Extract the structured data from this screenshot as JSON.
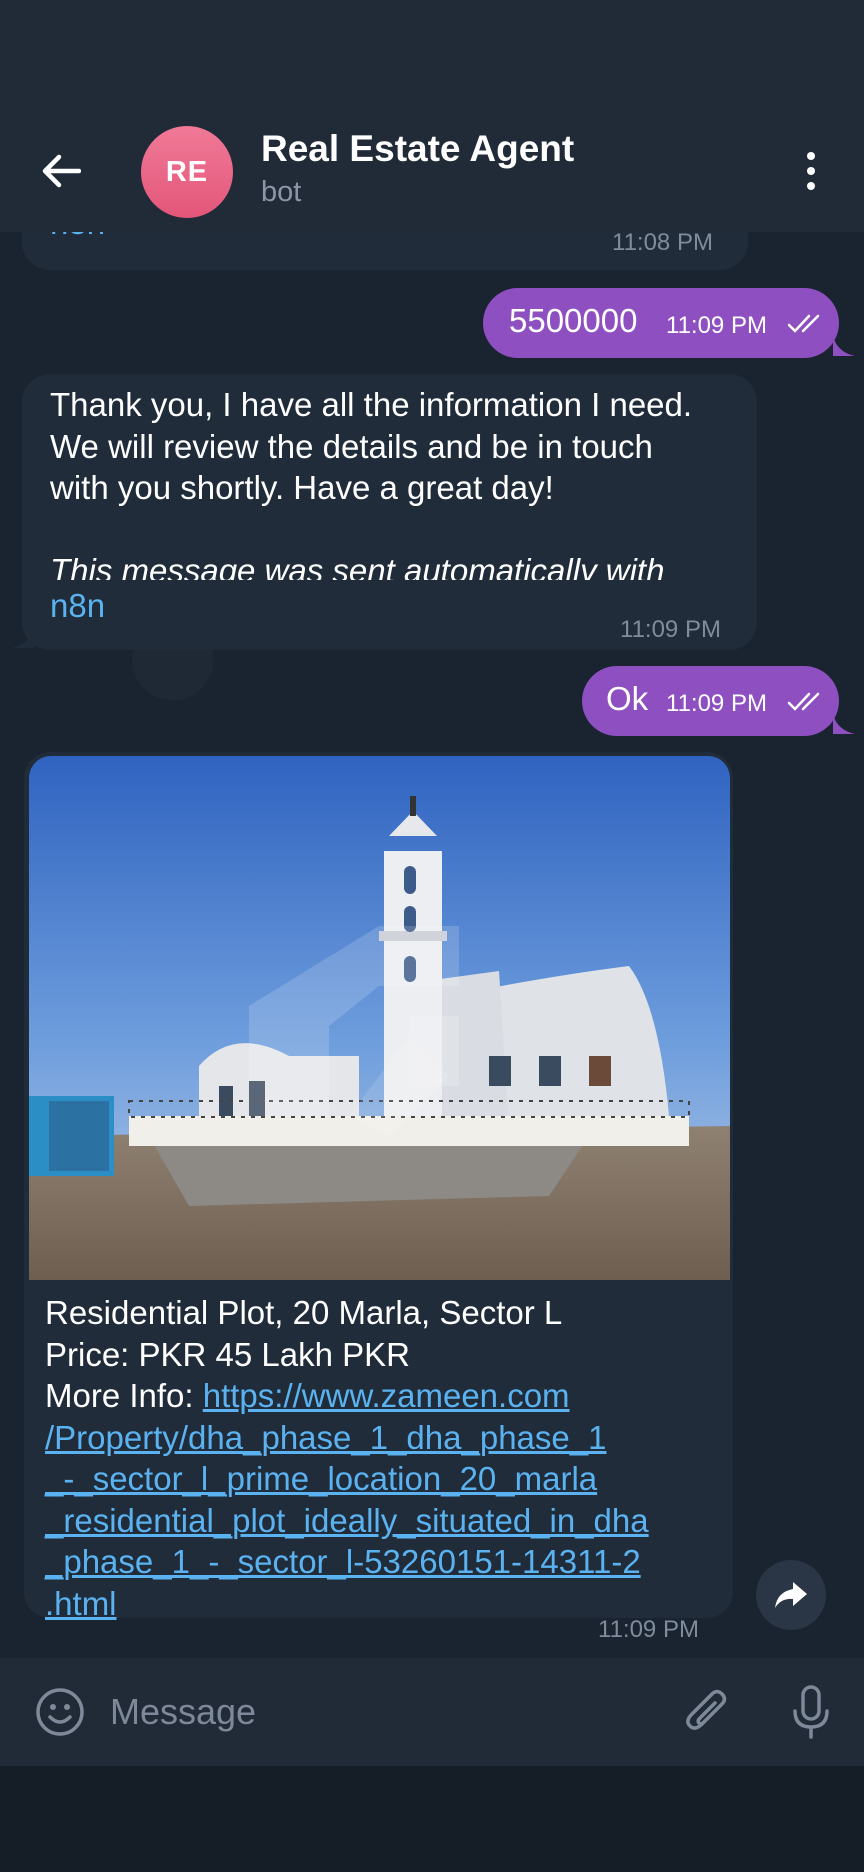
{
  "header": {
    "back_icon": "arrow-left-icon",
    "avatar_initials": "RE",
    "title": "Real Estate Agent",
    "subtitle": "bot",
    "menu_icon": "more-vertical-icon"
  },
  "messages": [
    {
      "direction": "in",
      "text": "n8n",
      "time": "11:08 PM"
    },
    {
      "direction": "out",
      "text": "5500000",
      "time": "11:09 PM",
      "status": "read"
    },
    {
      "direction": "in",
      "lines": [
        "Thank you, I have all the information I need.",
        "We will review the details and be in touch",
        "with you shortly. Have a great day!"
      ],
      "italic_lines": [
        "This message was sent automatically with"
      ],
      "link_text": "n8n",
      "time": "11:09 PM"
    },
    {
      "direction": "out",
      "text": "Ok",
      "time": "11:09 PM",
      "status": "read"
    },
    {
      "direction": "in",
      "line1": "Residential Plot, 20 Marla, Sector L",
      "line2": "Price: PKR 45 Lakh PKR",
      "more_info_label": "More Info: ",
      "url_lines": [
        "https://www.zameen.com",
        "/Property/dha_phase_1_dha_phase_1",
        "_-_sector_l_prime_location_20_marla",
        "_residential_plot_ideally_situated_in_dha",
        "_phase_1_-_sector_l-53260151-14311-2",
        ".html"
      ],
      "time": "11:09 PM"
    }
  ],
  "composer": {
    "placeholder": "Message",
    "emoji_icon": "emoji-icon",
    "attach_icon": "paperclip-icon",
    "mic_icon": "microphone-icon"
  },
  "colors": {
    "background": "#1a2330",
    "header": "#212b38",
    "incoming_bubble": "#212c3a",
    "outgoing_bubble": "#8e4fc0",
    "link": "#5ab3f0",
    "avatar": "#e3567a"
  }
}
